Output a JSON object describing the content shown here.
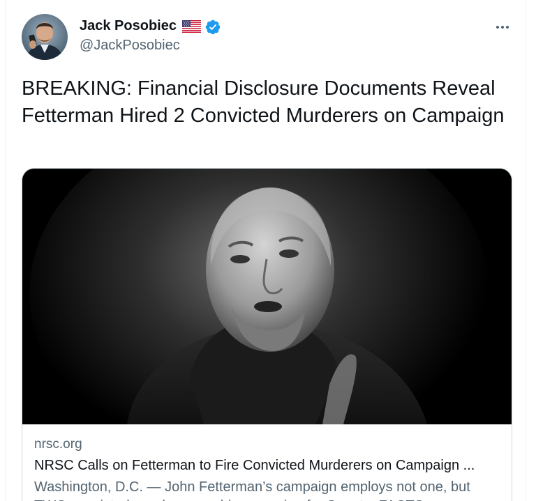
{
  "author": {
    "display_name": "Jack Posobiec",
    "handle": "@JackPosobiec",
    "flag_icon": "us-flag-icon",
    "verified_icon": "verified-badge-icon",
    "verified_color": "#1d9bf0"
  },
  "more_icon": "more-dots-icon",
  "tweet": {
    "text": "BREAKING: Financial Disclosure Documents Reveal Fetterman Hired 2 Convicted Murderers on Campaign"
  },
  "card": {
    "image_icon": "portrait-photo",
    "domain": "nrsc.org",
    "title": "NRSC Calls on Fetterman to Fire Convicted Murderers on Campaign ...",
    "description": "Washington, D.C.  — John Fetterman’s campaign employs not one, but TWO convicted murderers on his campaign for Senate. FACTS:"
  },
  "colors": {
    "text_primary": "#0f1419",
    "text_secondary": "#536471",
    "border": "#cfd9de"
  }
}
